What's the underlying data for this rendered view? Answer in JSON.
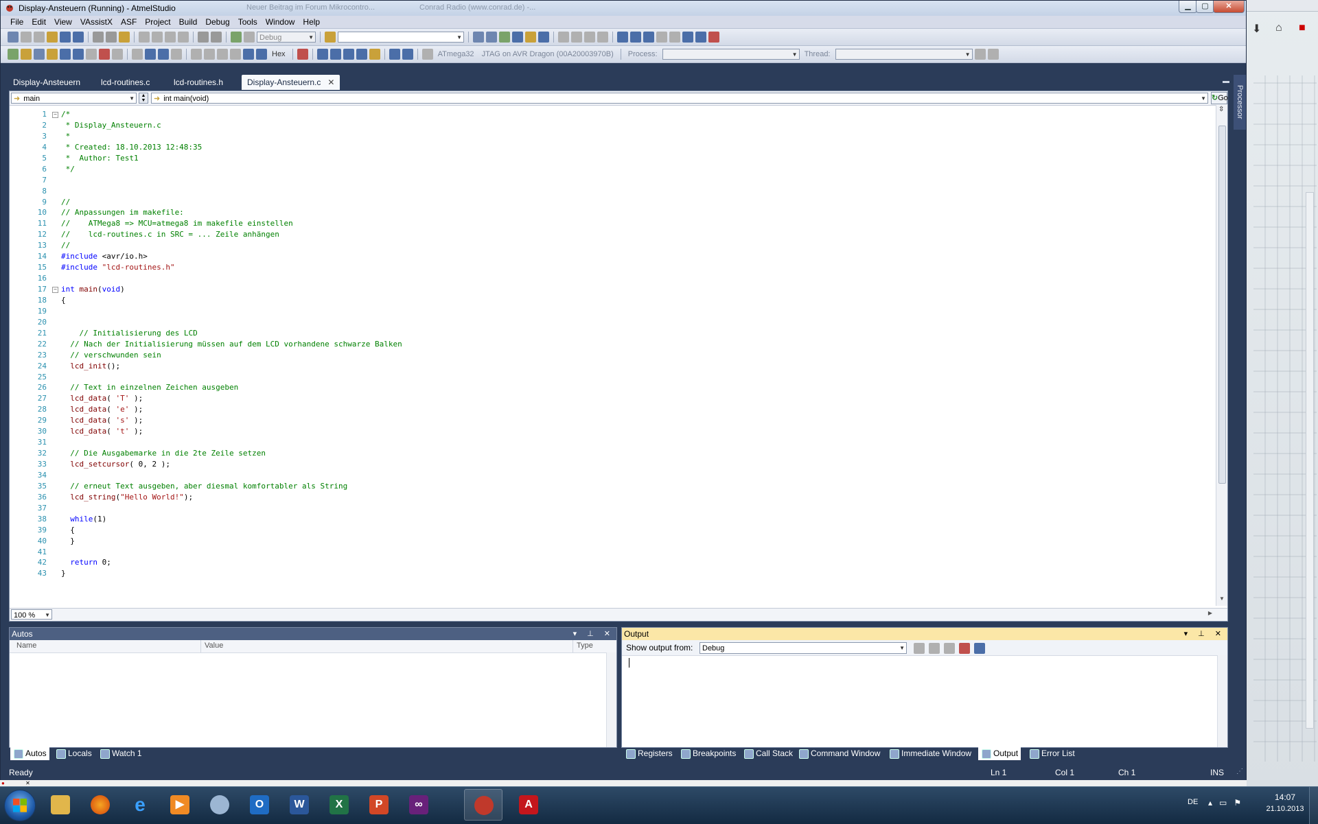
{
  "window": {
    "title": "Display-Ansteuern (Running) - AtmelStudio",
    "background_tabs": [
      "Neuer Beitrag im Forum Mikrocontro...",
      "Conrad Radio (www.conrad.de) -..."
    ]
  },
  "colors": {
    "accent": "#2b3c59",
    "code_comment": "#008000",
    "code_keyword": "#0000ff",
    "code_string": "#a31515",
    "code_function": "#800000",
    "line_number": "#2b91af",
    "output_header": "#fbe7a7"
  },
  "menu": [
    "File",
    "Edit",
    "View",
    "VAssistX",
    "ASF",
    "Project",
    "Build",
    "Debug",
    "Tools",
    "Window",
    "Help"
  ],
  "toolbar1": {
    "config": "Debug",
    "find_value": ""
  },
  "toolbar2": {
    "hex_label": "Hex",
    "device": "ATmega32",
    "tool": "JTAG on AVR Dragon (00A20003970B)",
    "process_label": "Process:",
    "process_value": "",
    "thread_label": "Thread:",
    "thread_value": ""
  },
  "tabs": [
    {
      "label": "Display-Ansteuern",
      "active": false
    },
    {
      "label": "lcd-routines.c",
      "active": false
    },
    {
      "label": "lcd-routines.h",
      "active": false
    },
    {
      "label": "Display-Ansteuern.c",
      "active": true
    }
  ],
  "side_tab": "Processor",
  "navbar": {
    "scope": "main",
    "function": "int main(void)",
    "go": "Go"
  },
  "code_lines": [
    "/*",
    " * Display_Ansteuern.c",
    " *",
    " * Created: 18.10.2013 12:48:35",
    " *  Author: Test1",
    " */",
    "",
    "",
    "//",
    "// Anpassungen im makefile:",
    "//    ATMega8 => MCU=atmega8 im makefile einstellen",
    "//    lcd-routines.c in SRC = ... Zeile anhängen",
    "//",
    "#include <avr/io.h>",
    "#include \"lcd-routines.h\"",
    "",
    "int main(void)",
    "{",
    "",
    "",
    "    // Initialisierung des LCD",
    "  // Nach der Initialisierung müssen auf dem LCD vorhandene schwarze Balken",
    "  // verschwunden sein",
    "  lcd_init();",
    "",
    "  // Text in einzelnen Zeichen ausgeben",
    "  lcd_data( 'T' );",
    "  lcd_data( 'e' );",
    "  lcd_data( 's' );",
    "  lcd_data( 't' );",
    "",
    "  // Die Ausgabemarke in die 2te Zeile setzen",
    "  lcd_setcursor( 0, 2 );",
    "",
    "  // erneut Text ausgeben, aber diesmal komfortabler als String",
    "  lcd_string(\"Hello World!\");",
    "",
    "  while(1)",
    "  {",
    "  }",
    "",
    "  return 0;",
    "}"
  ],
  "zoom": "100 %",
  "autos": {
    "title": "Autos",
    "columns": [
      "Name",
      "Value",
      "Type"
    ]
  },
  "output": {
    "title": "Output",
    "show_from_label": "Show output from:",
    "source": "Debug"
  },
  "left_panel_tabs": [
    "Autos",
    "Locals",
    "Watch 1"
  ],
  "right_panel_tabs": [
    "Registers",
    "Breakpoints",
    "Call Stack",
    "Command Window",
    "Immediate Window",
    "Output",
    "Error List"
  ],
  "status": {
    "text": "Ready",
    "ln": "Ln 1",
    "col": "Col 1",
    "ch": "Ch 1",
    "mode": "INS"
  },
  "taskbar": {
    "lang": "DE",
    "time": "14:07",
    "date": "21.10.2013"
  }
}
